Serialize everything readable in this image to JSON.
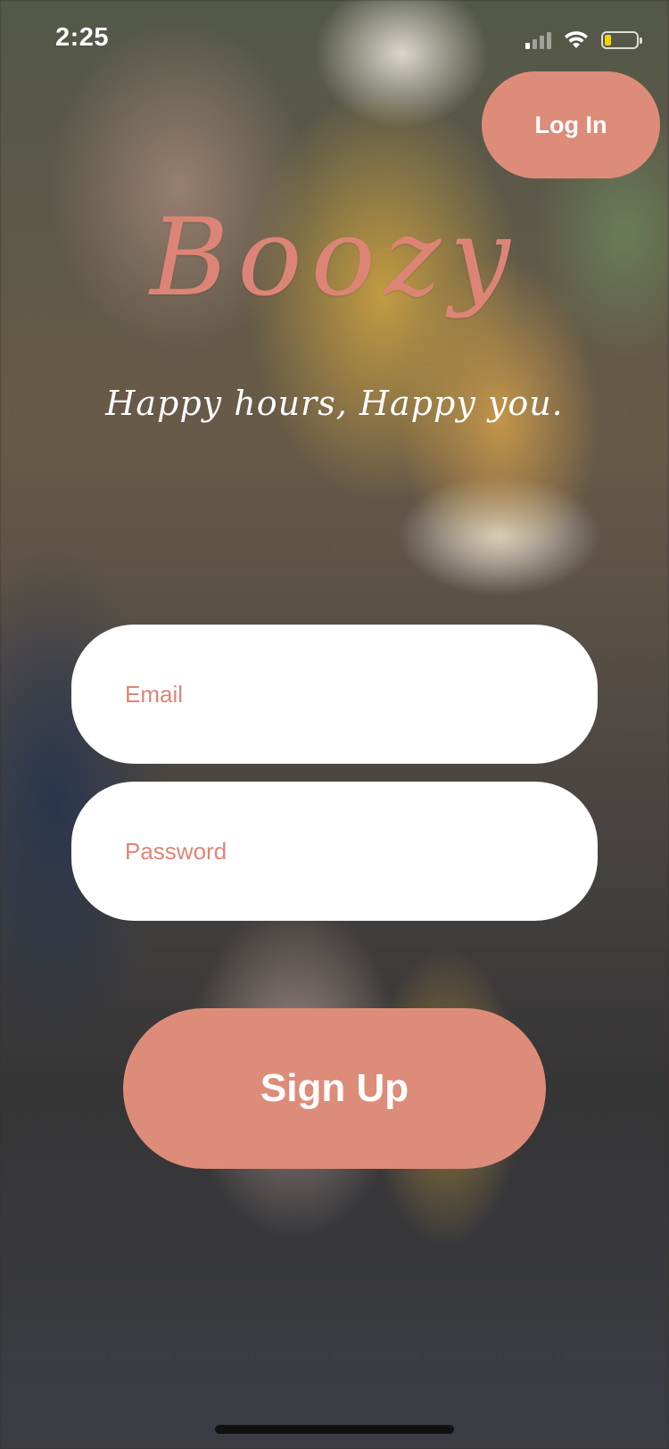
{
  "status_bar": {
    "time": "2:25",
    "icons": [
      "cellular-signal-icon",
      "wifi-icon",
      "battery-icon"
    ],
    "battery_color": "#f4d400"
  },
  "header": {
    "login_label": "Log In"
  },
  "brand": {
    "title": "Boozy",
    "tagline": "Happy hours, Happy you."
  },
  "form": {
    "email_placeholder": "Email",
    "password_placeholder": "Password",
    "signup_label": "Sign Up"
  },
  "colors": {
    "accent": "#dd8c79",
    "title": "#dc8576",
    "field_bg": "#ffffff"
  }
}
